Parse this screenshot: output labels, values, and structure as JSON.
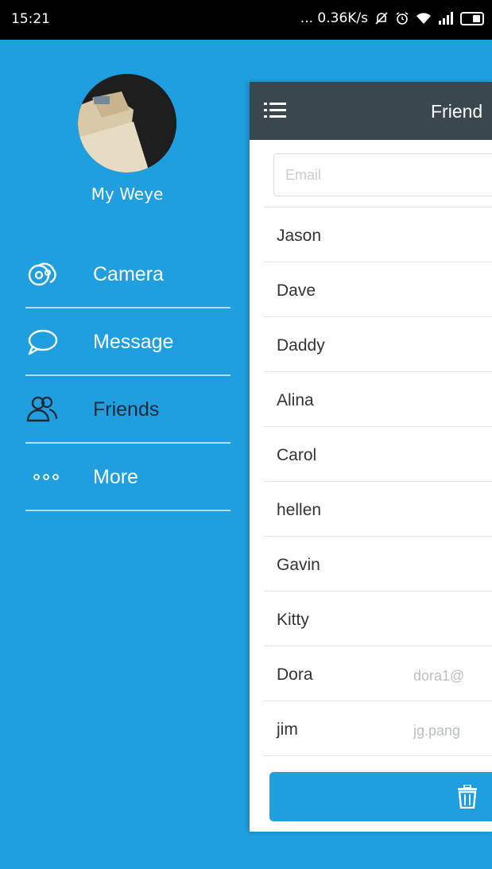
{
  "status_bar": {
    "time": "15:21",
    "network_speed": "... 0.36K/s",
    "icons": [
      "notification-mute-icon",
      "alarm-icon",
      "wifi-icon",
      "signal-icon",
      "battery-icon"
    ]
  },
  "drawer": {
    "profile_name": "My Weye",
    "items": [
      {
        "label": "Camera",
        "icon": "camera-icon"
      },
      {
        "label": "Message",
        "icon": "message-icon"
      },
      {
        "label": "Friends",
        "icon": "friends-icon"
      },
      {
        "label": "More",
        "icon": "more-icon"
      }
    ]
  },
  "main": {
    "title": "Friend",
    "email_placeholder": "Email",
    "friends": [
      {
        "name": "Jason",
        "email": ""
      },
      {
        "name": "Dave",
        "email": ""
      },
      {
        "name": "Daddy",
        "email": ""
      },
      {
        "name": "Alina",
        "email": ""
      },
      {
        "name": "Carol",
        "email": ""
      },
      {
        "name": "hellen",
        "email": ""
      },
      {
        "name": "Gavin",
        "email": ""
      },
      {
        "name": "Kitty",
        "email": ""
      },
      {
        "name": "Dora",
        "email": "dora1@"
      },
      {
        "name": "jim",
        "email": "jg.pang"
      }
    ],
    "delete_icon": "trash-icon"
  },
  "colors": {
    "drawer_bg": "#1f9fe0",
    "appbar_bg": "#3a474e",
    "status_bar_bg": "#000000",
    "accent": "#1f9fe0"
  }
}
